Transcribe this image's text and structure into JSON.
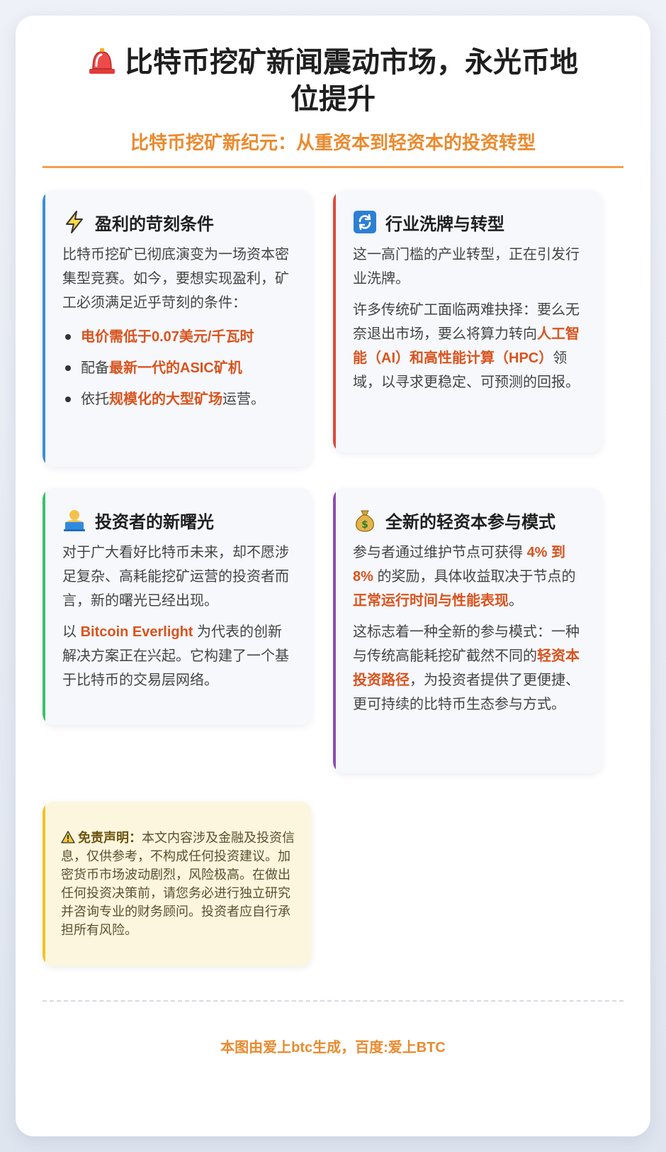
{
  "header": {
    "title": "比特币挖矿新闻震动市场，永光币地位提升",
    "subtitle": "比特币挖矿新纪元：从重资本到轻资本的投资转型"
  },
  "cards": {
    "profit": {
      "icon": "lightning-icon",
      "title": "盈利的苛刻条件",
      "intro": "比特币挖矿已彻底演变为一场资本密集型竞赛。如今，要想实现盈利，矿工必须满足近乎苛刻的条件：",
      "bullets": [
        {
          "pre": "",
          "hl": "电价需低于0.07美元/千瓦时",
          "post": ""
        },
        {
          "pre": "配备",
          "hl": "最新一代的ASIC矿机",
          "post": ""
        },
        {
          "pre": "依托",
          "hl": "规模化的大型矿场",
          "post": "运营。"
        }
      ]
    },
    "reshuffle": {
      "icon": "refresh-icon",
      "title": "行业洗牌与转型",
      "p1": "这一高门槛的产业转型，正在引发行业洗牌。",
      "p2_pre": "许多传统矿工面临两难抉择：要么无奈退出市场，要么将算力转向",
      "p2_hl": "人工智能（AI）和高性能计算（HPC）",
      "p2_post": "领域，以寻求更稳定、可预测的回报。"
    },
    "investor": {
      "icon": "person-laptop-icon",
      "title": "投资者的新曙光",
      "p1": "对于广大看好比特币未来，却不愿涉足复杂、高耗能挖矿运营的投资者而言，新的曙光已经出现。",
      "p2_pre": "以 ",
      "p2_hl": "Bitcoin Everlight",
      "p2_post": " 为代表的创新解决方案正在兴起。它构建了一个基于比特币的交易层网络。"
    },
    "light": {
      "icon": "money-bag-icon",
      "title": "全新的轻资本参与模式",
      "p1_pre": "参与者通过维护节点可获得 ",
      "p1_hl1": "4% 到 8%",
      "p1_mid": " 的奖励，具体收益取决于节点的",
      "p1_hl2": "正常运行时间与性能表现",
      "p1_post": "。",
      "p2_pre": "这标志着一种全新的参与模式：一种与传统高能耗挖矿截然不同的",
      "p2_hl": "轻资本投资路径",
      "p2_post": "，为投资者提供了更便捷、更可持续的比特币生态参与方式。"
    }
  },
  "disclaimer": {
    "icon": "warning-icon",
    "heading": "免责声明：",
    "text": "本文内容涉及金融及投资信息，仅供参考，不构成任何投资建议。加密货币市场波动剧烈，风险极高。在做出任何投资决策前，请您务必进行独立研究并咨询专业的财务顾问。投资者应自行承担所有风险。"
  },
  "footer": {
    "text": "本图由爱上btc生成，百度:爱上BTC"
  },
  "colors": {
    "accent": "#ea8a2e",
    "highlight": "#d9531e"
  }
}
